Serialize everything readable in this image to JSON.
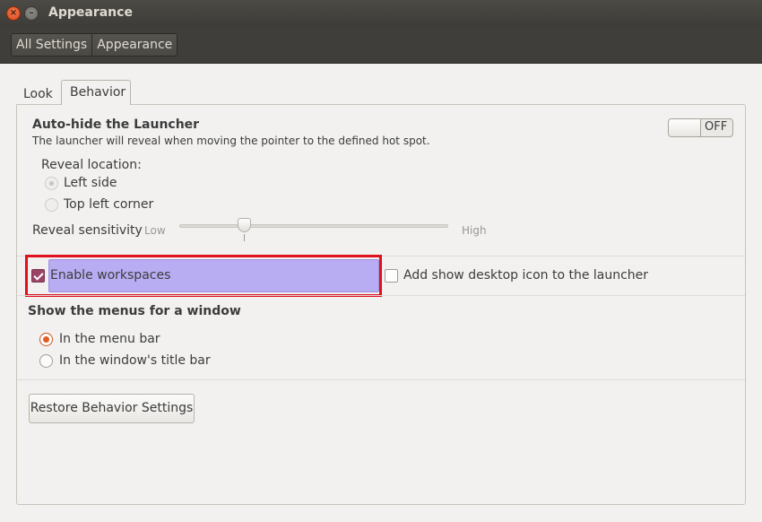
{
  "window": {
    "title": "Appearance",
    "close_glyph": "×",
    "minimize_glyph": "–"
  },
  "breadcrumb": [
    "All Settings",
    "Appearance"
  ],
  "tabs": [
    {
      "label": "Look",
      "active": false
    },
    {
      "label": "Behavior",
      "active": true
    }
  ],
  "autohide": {
    "title": "Auto-hide the Launcher",
    "description": "The launcher will reveal when moving the pointer to the defined hot spot.",
    "switch_label": "OFF",
    "switch_on": false,
    "reveal_location_label": "Reveal location:",
    "reveal_options": [
      {
        "label": "Left side",
        "selected": true
      },
      {
        "label": "Top left corner",
        "selected": false
      }
    ],
    "sensitivity_label": "Reveal sensitivity",
    "sensitivity_low": "Low",
    "sensitivity_high": "High",
    "sensitivity_value_fraction": 0.24
  },
  "workspaces": {
    "label": "Enable workspaces",
    "checked": true
  },
  "desktop_icon": {
    "label": "Add show desktop icon to the launcher",
    "checked": false
  },
  "menus": {
    "title": "Show the menus for a window",
    "options": [
      {
        "label": "In the menu bar",
        "selected": true
      },
      {
        "label": "In the window's title bar",
        "selected": false
      }
    ]
  },
  "restore_button": "Restore Behavior Settings",
  "colors": {
    "accent_radio": "#df5e23",
    "checkbox_checked": "#9c4467",
    "highlight_fill": "#b8acf2",
    "highlight_border": "#e0101e",
    "titlebar": "#3d3c38"
  }
}
